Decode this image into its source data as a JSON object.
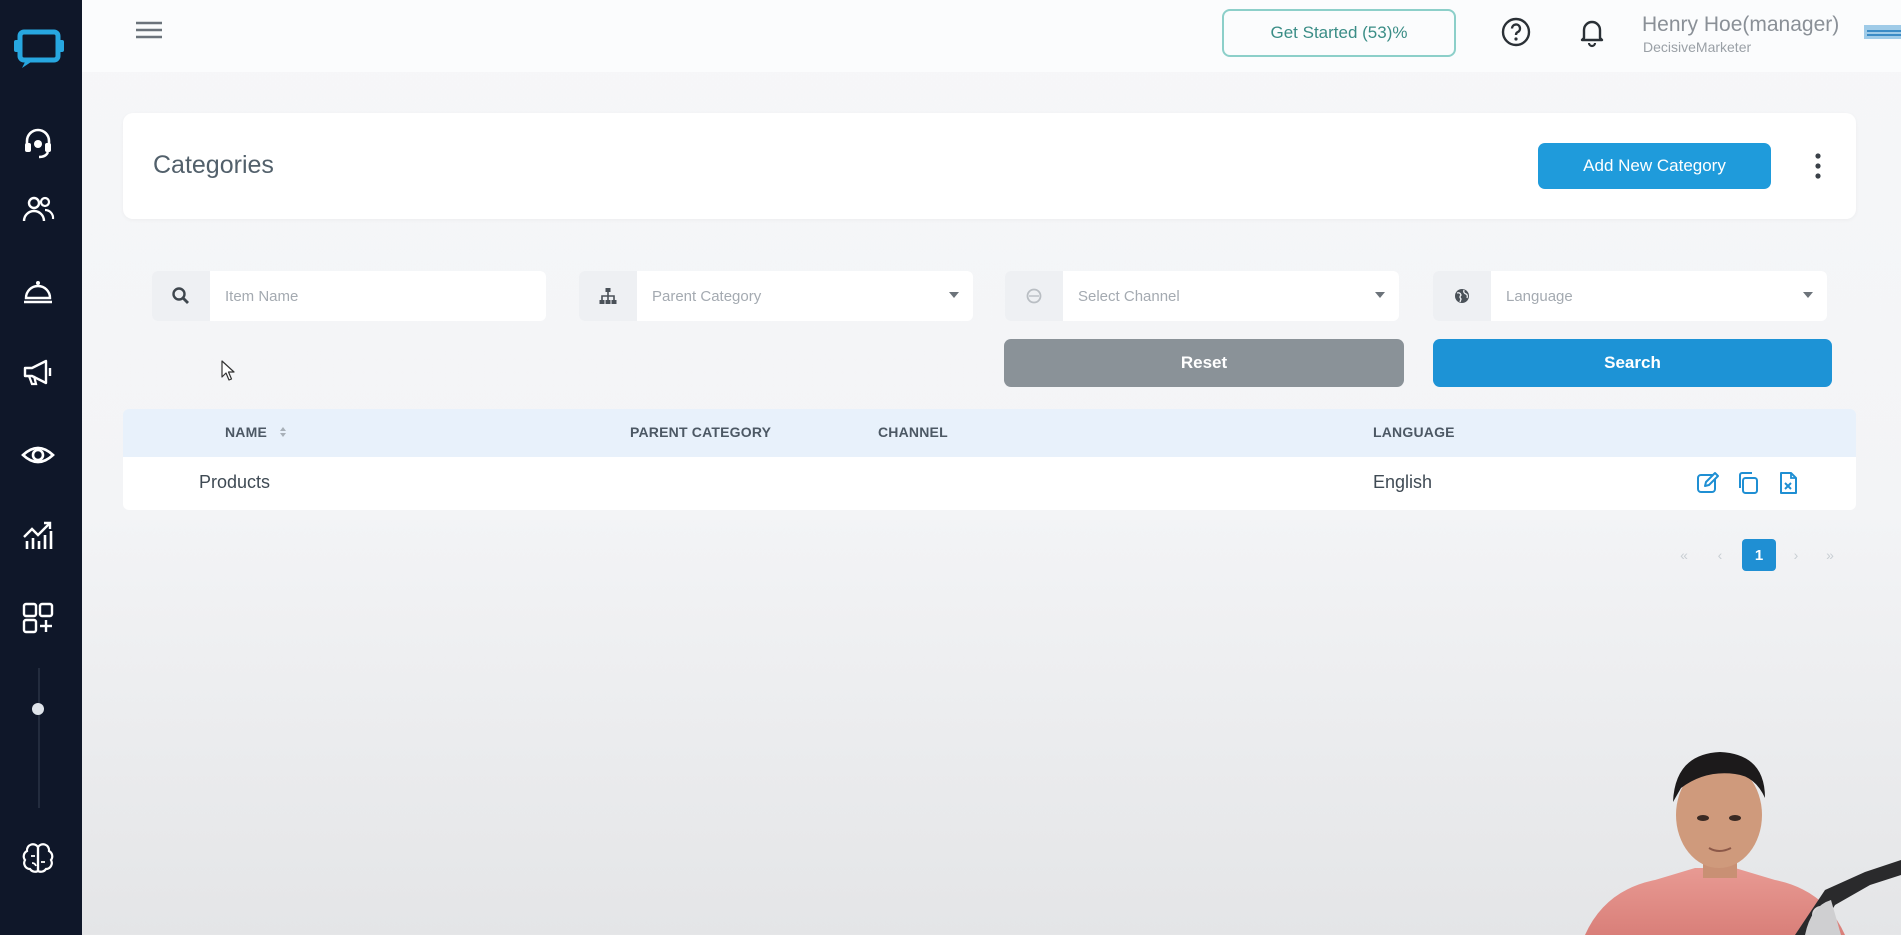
{
  "colors": {
    "sidebar_bg": "#0f1729",
    "accent": "#1f9bdb",
    "reset_bg": "#8a9298",
    "get_started_border": "#8ccfc9",
    "table_head_bg": "#e8f1fb"
  },
  "sidebar": {
    "icons": [
      "logo-icon",
      "headset-icon",
      "users-icon",
      "service-bell-icon",
      "megaphone-icon",
      "eye-icon",
      "analytics-chart-icon",
      "apps-add-icon",
      "brain-icon"
    ]
  },
  "topbar": {
    "get_started_label": "Get Started (53)%",
    "user_name": "Henry Hoe(manager)",
    "user_org": "DecisiveMarketer"
  },
  "header": {
    "title": "Categories",
    "add_button_label": "Add New Category"
  },
  "filters": {
    "item_name_placeholder": "Item Name",
    "parent_category_label": "Parent Category",
    "channel_label": "Select Channel",
    "language_label": "Language",
    "reset_label": "Reset",
    "search_label": "Search"
  },
  "table": {
    "columns": [
      "NAME",
      "PARENT CATEGORY",
      "CHANNEL",
      "LANGUAGE"
    ],
    "rows": [
      {
        "name": "Products",
        "parent_category": "",
        "channel": "",
        "language": "English"
      }
    ]
  },
  "pagination": {
    "first": "«",
    "prev": "‹",
    "current": "1",
    "next": "›",
    "last": "»"
  }
}
